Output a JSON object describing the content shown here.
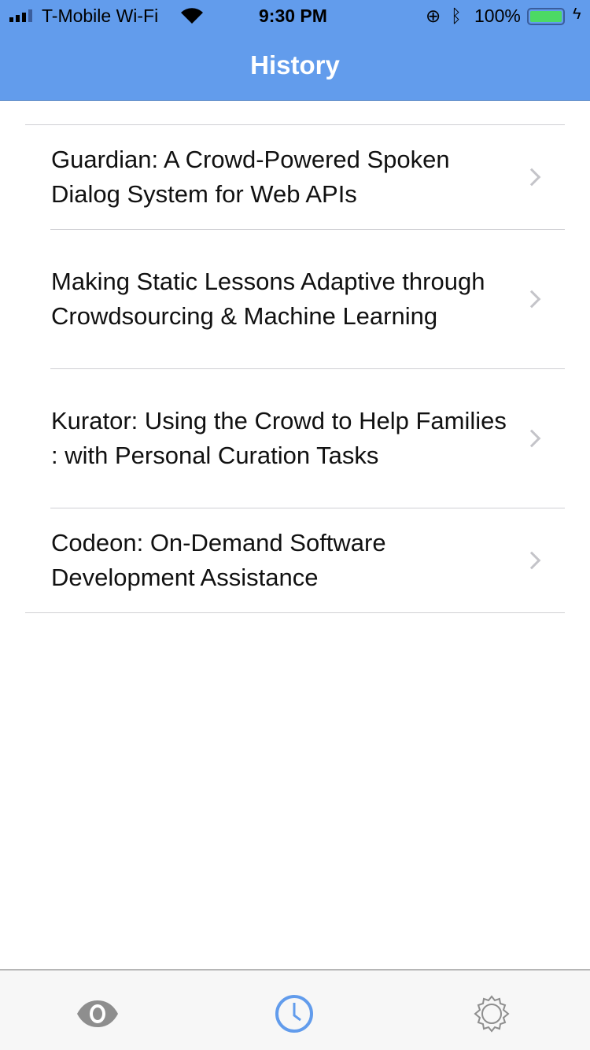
{
  "status_bar": {
    "carrier": "T-Mobile Wi-Fi",
    "time": "9:30 PM",
    "battery": "100%"
  },
  "header": {
    "title": "History"
  },
  "items": [
    {
      "title": "Guardian: A Crowd-Powered Spoken Dialog System for Web APIs"
    },
    {
      "title": "Making Static Lessons Adaptive through Crowdsourcing & Machine Learning"
    },
    {
      "title": "Kurator: Using the Crowd to Help Families : with Personal Curation Tasks"
    },
    {
      "title": "Codeon: On-Demand Software Development Assistance"
    }
  ],
  "tabs": [
    {
      "icon": "eye-icon"
    },
    {
      "icon": "clock-icon",
      "active": true
    },
    {
      "icon": "gear-icon"
    }
  ],
  "colors": {
    "accent": "#629cec",
    "battery": "#4cd964",
    "inactive": "#8e8e8e"
  }
}
